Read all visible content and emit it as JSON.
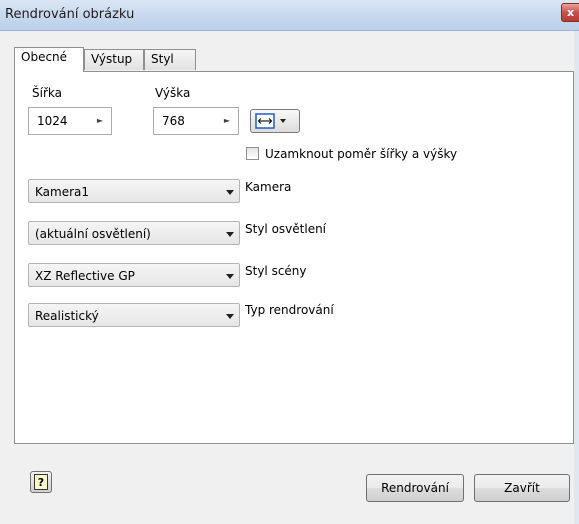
{
  "window": {
    "title": "Rendrování obrázku",
    "close_label": "x"
  },
  "tabs": [
    {
      "label": "Obecné",
      "active": true
    },
    {
      "label": "Výstup",
      "active": false
    },
    {
      "label": "Styl",
      "active": false
    }
  ],
  "size": {
    "width_label": "Šířka",
    "width_value": "1024",
    "height_label": "Výška",
    "height_value": "768"
  },
  "lock_ratio": {
    "label": "Uzamknout poměr šířky a výšky",
    "checked": false
  },
  "fields": [
    {
      "value": "Kamera1",
      "label": "Kamera"
    },
    {
      "value": "(aktuální osvětlení)",
      "label": "Styl osvětlení"
    },
    {
      "value": "XZ Reflective GP",
      "label": "Styl scény"
    },
    {
      "value": "Realistický",
      "label": "Typ rendrování"
    }
  ],
  "buttons": {
    "render": "Rendrování",
    "close": "Zavřít"
  },
  "icons": {
    "help": "help-icon",
    "size_mode": "horizontal-arrows-icon",
    "spin": "spin-right-arrow-icon",
    "dropdown": "dropdown-arrow-icon"
  },
  "colors": {
    "titlebar": "#c9d9ee",
    "close_button": "#c75050",
    "panel_border": "#8e8f8f",
    "accent_blue": "#1f5fbf"
  }
}
